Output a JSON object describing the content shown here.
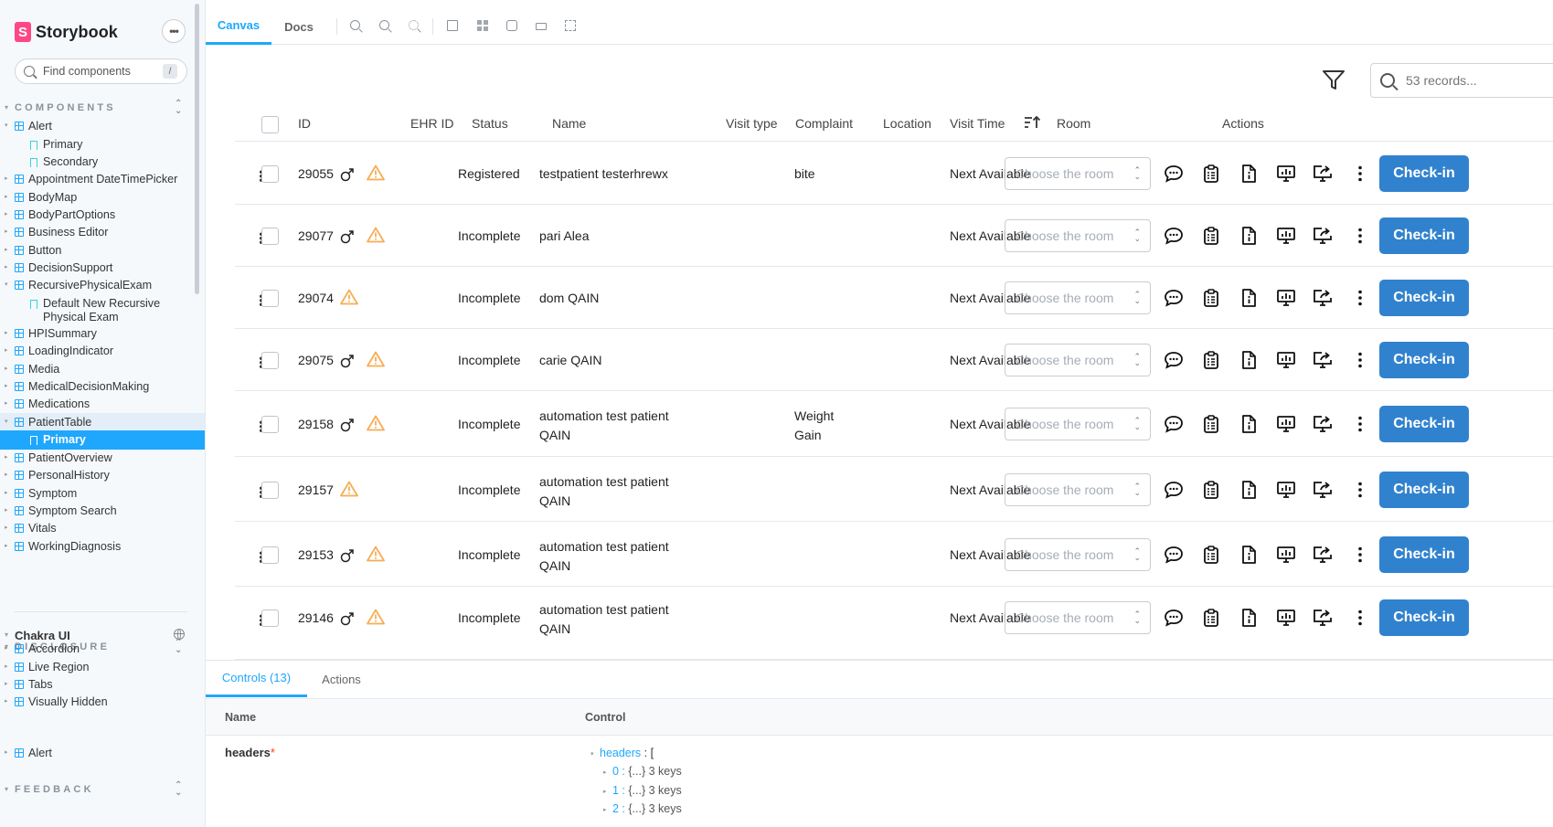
{
  "brand": {
    "name": "Storybook",
    "logo_letter": "S",
    "accent": "#ff4785"
  },
  "sidebar": {
    "menu_button": "•••",
    "search": {
      "placeholder": "Find components",
      "shortcut": "/"
    },
    "sections": [
      {
        "title": "COMPONENTS"
      },
      {
        "title": "DISCLOSURE"
      },
      {
        "title": "FEEDBACK"
      }
    ],
    "components": [
      "Alert",
      "Primary",
      "Secondary",
      "Appointment DateTimePicker",
      "BodyMap",
      "BodyPartOptions",
      "Business Editor",
      "Button",
      "DecisionSupport",
      "RecursivePhysicalExam",
      "Default New Recursive Physical Exam",
      "HPISummary",
      "LoadingIndicator",
      "Media",
      "MedicalDecisionMaking",
      "Medications",
      "PatientTable",
      "Primary",
      "PatientOverview",
      "PersonalHistory",
      "Symptom",
      "Symptom Search",
      "Vitals",
      "WorkingDiagnosis"
    ],
    "chakra": {
      "title": "Chakra UI"
    },
    "disclosure": [
      "Accordion",
      "Live Region",
      "Tabs",
      "Visually Hidden"
    ],
    "feedback": [
      "Alert"
    ]
  },
  "toolbar": {
    "tabs": [
      "Canvas",
      "Docs"
    ],
    "icons": [
      "zoom-in-icon",
      "zoom-out-icon",
      "zoom-reset-icon",
      "background-icon",
      "grid-icon",
      "viewport-icon",
      "measure-icon",
      "outline-icon"
    ]
  },
  "table": {
    "search_placeholder": "53 records...",
    "headers": [
      "ID",
      "EHR ID",
      "Status",
      "Name",
      "Visit type",
      "Complaint",
      "Location",
      "Visit Time",
      "Room",
      "Actions"
    ],
    "room_placeholder": "Choose the room",
    "checkin_label": "Check-in",
    "checkin_color": "#3182ce",
    "warning_color": "#f6ad55",
    "rows": [
      {
        "id": "29055",
        "male": true,
        "warn": true,
        "status": "Registered",
        "name": "testpatient testerhrewx",
        "complaint": "bite",
        "visit_time": "Next Available"
      },
      {
        "id": "29077",
        "male": true,
        "warn": true,
        "status": "Incomplete",
        "name": "pari Alea",
        "complaint": "",
        "visit_time": "Next Available"
      },
      {
        "id": "29074",
        "male": false,
        "warn": true,
        "status": "Incomplete",
        "name": "dom QAIN",
        "complaint": "",
        "visit_time": "Next Available"
      },
      {
        "id": "29075",
        "male": true,
        "warn": true,
        "status": "Incomplete",
        "name": "carie QAIN",
        "complaint": "",
        "visit_time": "Next Available"
      },
      {
        "id": "29158",
        "male": true,
        "warn": true,
        "status": "Incomplete",
        "name": "automation test patient QAIN",
        "complaint": "Weight Gain",
        "visit_time": "Next Available"
      },
      {
        "id": "29157",
        "male": false,
        "warn": true,
        "status": "Incomplete",
        "name": "automation test patient QAIN",
        "complaint": "",
        "visit_time": "Next Available"
      },
      {
        "id": "29153",
        "male": true,
        "warn": true,
        "status": "Incomplete",
        "name": "automation test patient QAIN",
        "complaint": "",
        "visit_time": "Next Available"
      },
      {
        "id": "29146",
        "male": true,
        "warn": true,
        "status": "Incomplete",
        "name": "automation test patient QAIN",
        "complaint": "",
        "visit_time": "Next Available"
      }
    ]
  },
  "addons": {
    "tabs": [
      "Controls (13)",
      "Actions"
    ],
    "columns": [
      "Name",
      "Control"
    ],
    "prop": {
      "name": "headers",
      "required_mark": "*"
    },
    "json": {
      "root_key": "headers",
      "root_open": " : [",
      "items": [
        {
          "key": "0",
          "sep": " : ",
          "value": "{...} 3 keys"
        },
        {
          "key": "1",
          "sep": " : ",
          "value": "{...} 3 keys"
        },
        {
          "key": "2",
          "sep": " : ",
          "value": "{...} 3 keys"
        }
      ]
    }
  }
}
